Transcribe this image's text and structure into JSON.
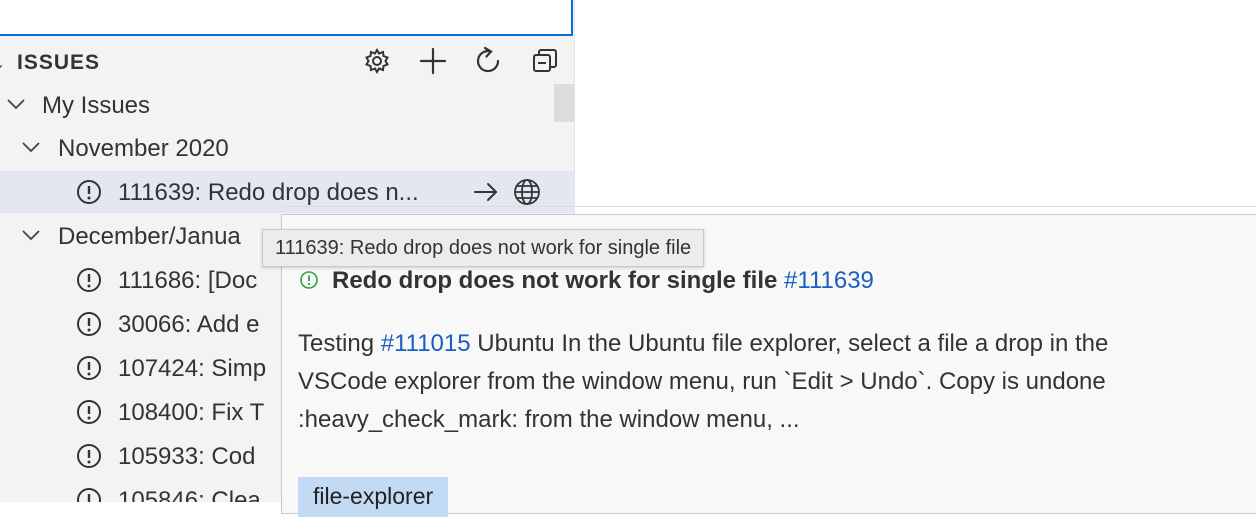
{
  "colors": {
    "accent": "#0a6fd8",
    "link": "#1a5fbf",
    "open_issue": "#2ea043",
    "label_bg": "#c2daf3"
  },
  "issues_view": {
    "title": "ISSUES",
    "toolbar_icons": [
      "gear-icon",
      "plus-icon",
      "refresh-icon",
      "collapse-all-icon"
    ],
    "tree": {
      "my_issues": "My Issues",
      "groups": [
        {
          "label": "November 2020",
          "items": [
            {
              "label": "111639: Redo drop does n...",
              "selected": true
            }
          ]
        },
        {
          "label": "December/Janua",
          "items": [
            {
              "label": "111686: [Doc"
            },
            {
              "label": "30066: Add e"
            },
            {
              "label": "107424: Simp"
            },
            {
              "label": "108400: Fix T"
            },
            {
              "label": "105933: Cod"
            },
            {
              "label": "105846: Clea"
            }
          ]
        }
      ]
    }
  },
  "tooltip": {
    "text": "111639: Redo drop does not work for single file"
  },
  "hover_card": {
    "title": "Redo drop does not work for single file",
    "number": "#111639",
    "body": {
      "prefix": "Testing ",
      "ref": "#111015",
      "line1_rest": " Ubuntu In the Ubuntu file explorer, select a file a drop in the",
      "line2": "VSCode explorer from the window menu, run `Edit > Undo`. Copy is undone",
      "line3": ":heavy_check_mark: from the window menu, ..."
    },
    "label": "file-explorer"
  }
}
